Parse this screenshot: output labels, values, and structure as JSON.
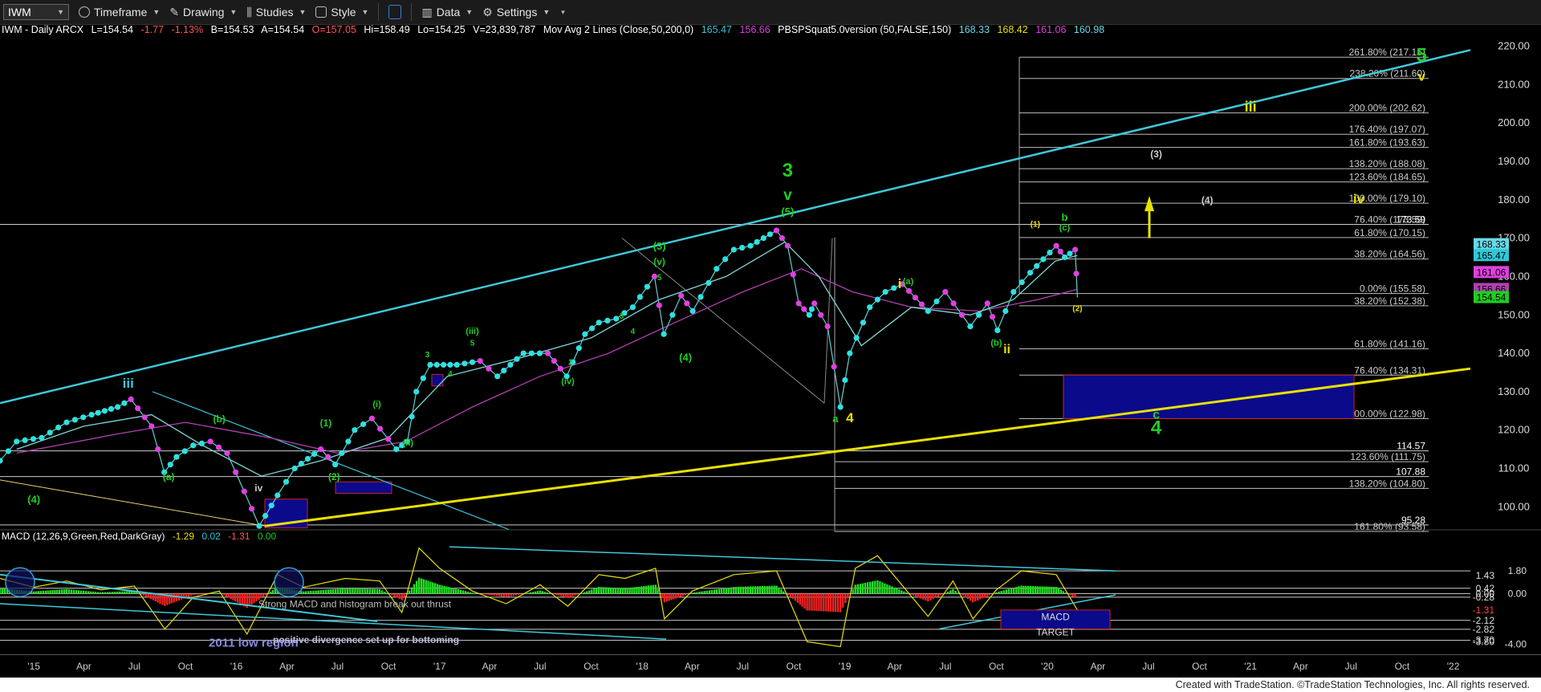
{
  "toolbar": {
    "symbol": "IWM",
    "timeframe": "Timeframe",
    "drawing": "Drawing",
    "studies": "Studies",
    "style": "Style",
    "data": "Data",
    "settings": "Settings"
  },
  "infobar": {
    "title": "IWM - Daily  ARCX",
    "last": "L=154.54",
    "chg": "-1.77",
    "pct": "-1.13%",
    "bid": "B=154.53",
    "ask": "A=154.54",
    "open": "O=157.05",
    "hi": "Hi=158.49",
    "lo": "Lo=154.25",
    "vol": "V=23,839,787",
    "ma_label": "Mov Avg 2 Lines (Close,50,200,0)",
    "ma1": "165.47",
    "ma2": "156.66",
    "pbs_label": "PBSPSquat5.0version (50,FALSE,150)",
    "pbs1": "168.33",
    "pbs2": "168.42",
    "pbs3": "161.06",
    "pbs4": "160.98"
  },
  "macd_info": {
    "label": "MACD (12,26,9,Green,Red,DarkGray)",
    "v1": "-1.29",
    "v2": "0.02",
    "v3": "-1.31",
    "v4": "0.00"
  },
  "colors": {
    "background": "#000000",
    "price_line": "#7fd8d8",
    "ma_fast": "#7fd8d8",
    "ma_slow": "#b040b0",
    "channel": "#3fc8d8",
    "support": "#e8e000",
    "wave_green": "#22cc22",
    "wave_yellow": "#e8e000",
    "target_box": "#0a0a8a",
    "dot_cyan": "#30e0e0",
    "dot_magenta": "#e040e0"
  },
  "chart_data": {
    "type": "line",
    "title": "IWM - Daily ARCX",
    "x_ticks": [
      "'15",
      "Apr",
      "Jul",
      "Oct",
      "'16",
      "Apr",
      "Jul",
      "Oct",
      "'17",
      "Apr",
      "Jul",
      "Oct",
      "'18",
      "Apr",
      "Jul",
      "Oct",
      "'19",
      "Apr",
      "Jul",
      "Oct",
      "'20",
      "Apr",
      "Jul",
      "Oct",
      "'21",
      "Apr",
      "Jul",
      "Oct",
      "'22"
    ],
    "y_ticks": [
      100,
      110,
      120,
      130,
      140,
      150,
      160,
      170,
      180,
      190,
      200,
      210,
      220
    ],
    "ylim": [
      94,
      222
    ],
    "price_series": {
      "x": [
        "2014-11-01",
        "2014-12-01",
        "2015-01-15",
        "2015-03-01",
        "2015-04-15",
        "2015-06-01",
        "2015-06-25",
        "2015-08-01",
        "2015-08-24",
        "2015-09-15",
        "2015-10-15",
        "2015-11-15",
        "2015-12-15",
        "2016-01-15",
        "2016-02-11",
        "2016-03-15",
        "2016-04-15",
        "2016-06-01",
        "2016-06-27",
        "2016-08-01",
        "2016-09-01",
        "2016-10-15",
        "2016-11-04",
        "2016-11-20",
        "2016-12-15",
        "2017-02-01",
        "2017-03-15",
        "2017-04-15",
        "2017-06-01",
        "2017-07-15",
        "2017-08-18",
        "2017-09-20",
        "2017-10-15",
        "2017-11-15",
        "2017-12-15",
        "2018-01-23",
        "2018-02-09",
        "2018-03-12",
        "2018-04-02",
        "2018-05-15",
        "2018-06-15",
        "2018-07-15",
        "2018-08-31",
        "2018-09-20",
        "2018-10-10",
        "2018-10-29",
        "2018-11-07",
        "2018-12-01",
        "2018-12-24",
        "2019-01-10",
        "2019-02-15",
        "2019-03-15",
        "2019-04-15",
        "2019-05-31",
        "2019-07-01",
        "2019-08-15",
        "2019-09-15",
        "2019-10-03",
        "2019-11-01",
        "2019-12-01",
        "2020-01-17",
        "2020-02-01",
        "2020-02-20",
        "2020-02-24"
      ],
      "close": [
        112,
        117,
        118,
        122,
        124,
        126,
        128,
        121,
        109,
        113,
        116,
        117,
        114,
        104,
        95,
        103,
        110,
        115,
        111,
        120,
        123,
        115,
        117,
        130,
        137,
        137,
        138,
        134,
        140,
        140,
        134,
        145,
        148,
        149,
        152,
        160,
        145,
        155,
        151,
        162,
        167,
        168,
        172,
        168,
        153,
        150,
        153,
        147,
        126,
        140,
        152,
        156,
        158,
        151,
        156,
        147,
        153,
        146,
        156,
        161,
        168,
        165,
        167,
        154.54
      ]
    },
    "ma_50": {
      "x": [
        "2014-12-01",
        "2015-04-01",
        "2015-08-01",
        "2015-11-01",
        "2016-02-15",
        "2016-06-01",
        "2016-10-01",
        "2017-01-15",
        "2017-06-01",
        "2017-10-01",
        "2018-02-01",
        "2018-06-01",
        "2018-09-15",
        "2018-11-15",
        "2019-01-31",
        "2019-05-01",
        "2019-08-15",
        "2019-11-01",
        "2020-01-15",
        "2020-02-24"
      ],
      "values": [
        115,
        121,
        124,
        116,
        108,
        112,
        118,
        134,
        139,
        144,
        154,
        160,
        169,
        160,
        142,
        152,
        150,
        154,
        164,
        165.47
      ]
    },
    "ma_200": {
      "x": [
        "2014-12-01",
        "2015-06-01",
        "2015-10-01",
        "2016-03-01",
        "2016-07-01",
        "2016-11-01",
        "2017-03-01",
        "2017-07-01",
        "2017-11-01",
        "2018-03-01",
        "2018-07-01",
        "2018-10-15",
        "2019-01-15",
        "2019-05-01",
        "2019-09-01",
        "2019-12-15",
        "2020-02-24"
      ],
      "values": [
        114,
        119,
        122,
        118,
        114,
        117,
        126,
        134,
        140,
        148,
        156,
        162,
        156,
        152,
        151,
        154,
        156.66
      ]
    },
    "fib_levels": [
      {
        "label": "261.80%",
        "value": 217.15,
        "text": "261.80% (217.15)"
      },
      {
        "label": "238.20%",
        "value": 211.6,
        "text": "238.20% (211.60)"
      },
      {
        "label": "200.00%",
        "value": 202.62,
        "text": "200.00% (202.62)"
      },
      {
        "label": "176.40%",
        "value": 197.07,
        "text": "176.40% (197.07)"
      },
      {
        "label": "161.80%",
        "value": 193.63,
        "text": "161.80% (193.63)"
      },
      {
        "label": "138.20%",
        "value": 188.08,
        "text": "138.20% (188.08)"
      },
      {
        "label": "123.60%",
        "value": 184.65,
        "text": "123.60% (184.65)"
      },
      {
        "label": "100.00%",
        "value": 179.1,
        "text": "100.00% (179.10)"
      },
      {
        "label": "76.40%",
        "value": 173.59,
        "text": "76.40% (173.59)"
      },
      {
        "label": "61.80%",
        "value": 170.15,
        "text": "61.80% (170.15)"
      },
      {
        "label": "38.20%",
        "value": 164.56,
        "text": "38.20% (164.56)"
      },
      {
        "label": "0.00%",
        "value": 155.58,
        "text": "0.00% (155.58)"
      },
      {
        "label": "38.20%",
        "value": 152.38,
        "text": "38.20% (152.38)"
      },
      {
        "label": "61.80%",
        "value": 141.16,
        "text": "61.80% (141.16)"
      },
      {
        "label": "76.40%",
        "value": 134.31,
        "text": "76.40% (134.31)"
      },
      {
        "label": "100.00%",
        "value": 122.98,
        "text": "100.00% (122.98)"
      },
      {
        "label": "123.60%",
        "value": 111.75,
        "text": "123.60% (111.75)"
      },
      {
        "label": "138.20%",
        "value": 104.8,
        "text": "138.20% (104.80)"
      },
      {
        "label": "161.80%",
        "value": 93.58,
        "text": "161.80% (93.58)"
      }
    ],
    "price_labels": [
      {
        "value": 173.59,
        "text": "173.59"
      },
      {
        "value": 114.57,
        "text": "114.57"
      },
      {
        "value": 107.88,
        "text": "107.88"
      },
      {
        "value": 95.28,
        "text": "95.28"
      }
    ],
    "side_badges": [
      {
        "value": 168.33,
        "text": "168.33",
        "color": "#6ad8e8"
      },
      {
        "value": 165.47,
        "text": "165.47",
        "color": "#30c8d8"
      },
      {
        "value": 161.06,
        "text": "161.06",
        "color": "#e040e0"
      },
      {
        "value": 156.66,
        "text": "156.66",
        "color": "#b040b0"
      },
      {
        "value": 154.54,
        "text": "154.54",
        "color": "#22cc22"
      }
    ],
    "wave_labels": [
      {
        "text": "(4)",
        "date": "2015-01-01",
        "value": 101,
        "color": "#22cc22",
        "size": 13
      },
      {
        "text": "iii",
        "date": "2015-06-20",
        "value": 131,
        "color": "#30c8d8",
        "size": 17
      },
      {
        "text": "(a)",
        "date": "2015-09-01",
        "value": 107,
        "color": "#22cc22",
        "size": 12
      },
      {
        "text": "(b)",
        "date": "2015-12-01",
        "value": 122,
        "color": "#22cc22",
        "size": 12
      },
      {
        "text": "iv",
        "date": "2016-02-10",
        "value": 104,
        "color": "#cccccc",
        "size": 12
      },
      {
        "text": "(1)",
        "date": "2016-06-10",
        "value": 121,
        "color": "#22cc22",
        "size": 12
      },
      {
        "text": "(2)",
        "date": "2016-06-25",
        "value": 107,
        "color": "#22cc22",
        "size": 12
      },
      {
        "text": "(i)",
        "date": "2016-09-10",
        "value": 126,
        "color": "#22cc22",
        "size": 11
      },
      {
        "text": "(ii)",
        "date": "2016-11-05",
        "value": 116,
        "color": "#22cc22",
        "size": 11
      },
      {
        "text": "3",
        "date": "2016-12-10",
        "value": 139,
        "color": "#22cc22",
        "size": 10
      },
      {
        "text": "4",
        "date": "2017-01-20",
        "value": 134,
        "color": "#22cc22",
        "size": 10
      },
      {
        "text": "5",
        "date": "2017-03-01",
        "value": 142,
        "color": "#22cc22",
        "size": 10
      },
      {
        "text": "(iii)",
        "date": "2017-03-01",
        "value": 145,
        "color": "#22cc22",
        "size": 11
      },
      {
        "text": "2",
        "date": "2017-08-25",
        "value": 137,
        "color": "#22cc22",
        "size": 10
      },
      {
        "text": "(iv)",
        "date": "2017-08-20",
        "value": 132,
        "color": "#22cc22",
        "size": 11
      },
      {
        "text": "3",
        "date": "2017-11-25",
        "value": 149,
        "color": "#22cc22",
        "size": 10
      },
      {
        "text": "4",
        "date": "2017-12-15",
        "value": 145,
        "color": "#22cc22",
        "size": 10
      },
      {
        "text": "5",
        "date": "2018-02-01",
        "value": 159,
        "color": "#22cc22",
        "size": 10
      },
      {
        "text": "(v)",
        "date": "2018-02-01",
        "value": 163,
        "color": "#22cc22",
        "size": 12
      },
      {
        "text": "(3)",
        "date": "2018-02-01",
        "value": 167,
        "color": "#22cc22",
        "size": 13
      },
      {
        "text": "(4)",
        "date": "2018-03-20",
        "value": 138,
        "color": "#22cc22",
        "size": 13
      },
      {
        "text": "(5)",
        "date": "2018-09-20",
        "value": 176,
        "color": "#22cc22",
        "size": 13
      },
      {
        "text": "v",
        "date": "2018-09-20",
        "value": 180,
        "color": "#22cc22",
        "size": 19
      },
      {
        "text": "3",
        "date": "2018-09-20",
        "value": 186,
        "color": "#22cc22",
        "size": 24
      },
      {
        "text": "a",
        "date": "2018-12-15",
        "value": 122,
        "color": "#22cc22",
        "size": 13
      },
      {
        "text": "4",
        "date": "2019-01-10",
        "value": 122,
        "color": "#e8e000",
        "size": 17
      },
      {
        "text": "i",
        "date": "2019-04-10",
        "value": 157,
        "color": "#e8e000",
        "size": 17
      },
      {
        "text": "(a)",
        "date": "2019-04-25",
        "value": 158,
        "color": "#22cc22",
        "size": 11
      },
      {
        "text": "(b)",
        "date": "2019-10-01",
        "value": 142,
        "color": "#22cc22",
        "size": 11
      },
      {
        "text": "ii",
        "date": "2019-10-20",
        "value": 140,
        "color": "#e8e000",
        "size": 16
      },
      {
        "text": "(1)",
        "date": "2019-12-10",
        "value": 173,
        "color": "#e8e000",
        "size": 10
      },
      {
        "text": "b",
        "date": "2020-02-01",
        "value": 174.5,
        "color": "#22cc22",
        "size": 13
      },
      {
        "text": "(c)",
        "date": "2020-02-01",
        "value": 172,
        "color": "#22cc22",
        "size": 11
      },
      {
        "text": "(2)",
        "date": "2020-02-24",
        "value": 151,
        "color": "#e8e000",
        "size": 10
      },
      {
        "text": "(3)",
        "date": "2020-07-15",
        "value": 191,
        "color": "#cccccc",
        "size": 12
      },
      {
        "text": "(4)",
        "date": "2020-10-15",
        "value": 179,
        "color": "#cccccc",
        "size": 12
      },
      {
        "text": "iii",
        "date": "2021-01-01",
        "value": 203,
        "color": "#e8e000",
        "size": 18
      },
      {
        "text": "c",
        "date": "2020-07-15",
        "value": 123,
        "color": "#22cc22",
        "size": 16
      },
      {
        "text": "4",
        "date": "2020-07-15",
        "value": 119,
        "color": "#22cc22",
        "size": 24
      },
      {
        "text": "iv",
        "date": "2021-07-15",
        "value": 179,
        "color": "#e8e000",
        "size": 17
      },
      {
        "text": "v",
        "date": "2021-11-05",
        "value": 211,
        "color": "#e8e000",
        "size": 16
      },
      {
        "text": "5",
        "date": "2021-11-05",
        "value": 216,
        "color": "#22cc22",
        "size": 24
      }
    ],
    "macd_panel": {
      "label": "MACD (12,26,9,Green,Red,DarkGray)",
      "y_ticks": [
        "1.80",
        "0.00",
        "-4.00"
      ],
      "right_labels": [
        {
          "value": 1.43,
          "text": "1.43"
        },
        {
          "value": 0.42,
          "text": "0.42"
        },
        {
          "value": 0.0,
          "text": "0.00"
        },
        {
          "value": -0.28,
          "text": "-0.28"
        },
        {
          "value": -1.31,
          "text": "-1.31"
        },
        {
          "value": -2.12,
          "text": "-2.12"
        },
        {
          "value": -2.82,
          "text": "-2.82"
        },
        {
          "value": -3.7,
          "text": "-3.70"
        },
        {
          "value": -3.8,
          "text": "-3.80"
        }
      ],
      "annotations": [
        "Strong MACD and histogram break out thrust",
        "2011 low region",
        "positive divergence set up for bottoming",
        "MACD",
        "TARGET"
      ],
      "macd_values": {
        "x": [
          "2014-11-01",
          "2015-01-01",
          "2015-03-01",
          "2015-05-01",
          "2015-07-01",
          "2015-08-25",
          "2015-10-15",
          "2015-12-01",
          "2016-01-20",
          "2016-03-15",
          "2016-05-01",
          "2016-07-15",
          "2016-09-15",
          "2016-10-25",
          "2016-11-25",
          "2017-01-01",
          "2017-03-01",
          "2017-05-01",
          "2017-07-01",
          "2017-08-20",
          "2017-10-15",
          "2017-12-01",
          "2018-01-25",
          "2018-02-10",
          "2018-04-01",
          "2018-06-15",
          "2018-08-31",
          "2018-10-25",
          "2018-12-24",
          "2019-01-20",
          "2019-03-01",
          "2019-05-31",
          "2019-07-15",
          "2019-08-20",
          "2019-10-01",
          "2019-11-15",
          "2020-01-17",
          "2020-02-24"
        ],
        "values": [
          1.2,
          0.5,
          1.0,
          0.3,
          0.6,
          -2.8,
          -0.3,
          0.2,
          -3.2,
          1.5,
          0.5,
          1.2,
          1.0,
          -1.5,
          3.6,
          2.0,
          0.2,
          -0.8,
          0.7,
          -1.0,
          1.5,
          1.2,
          2.0,
          -2.0,
          0.2,
          1.5,
          1.8,
          -3.8,
          -4.2,
          2.0,
          3.0,
          -1.8,
          1.0,
          -2.0,
          0.3,
          1.8,
          1.5,
          -1.31
        ]
      }
    }
  },
  "footer_text": "Created with TradeStation. ©TradeStation Technologies, Inc. All rights reserved."
}
